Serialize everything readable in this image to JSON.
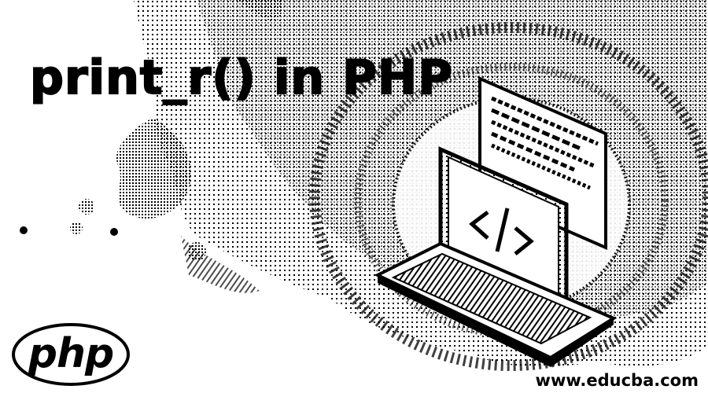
{
  "banner": {
    "title": "print_r() in PHP",
    "logo_text": "php",
    "website": "www.educba.com"
  },
  "colors": {
    "background": "#ffffff",
    "ink": "#000000"
  },
  "icons": {
    "illustration": "laptop-code-icon",
    "logo": "php-logo"
  }
}
